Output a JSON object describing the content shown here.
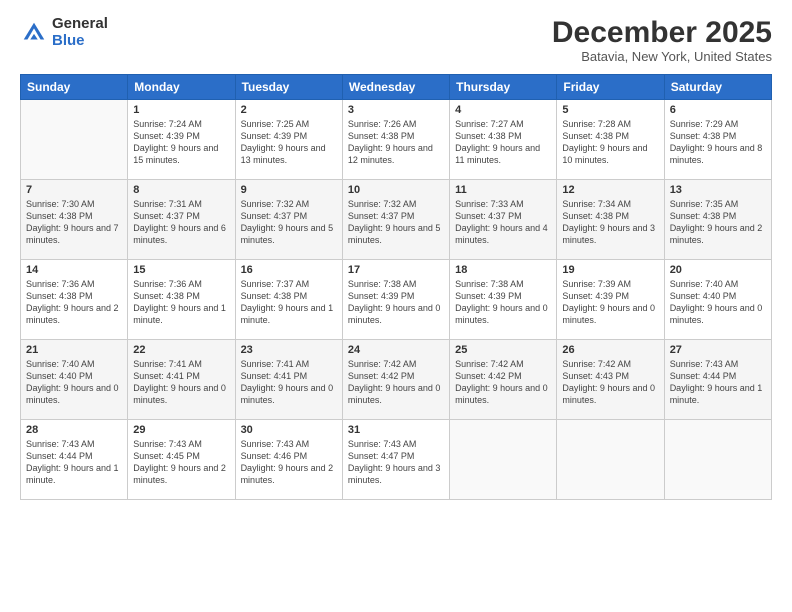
{
  "header": {
    "logo_general": "General",
    "logo_blue": "Blue",
    "month_title": "December 2025",
    "location": "Batavia, New York, United States"
  },
  "weekdays": [
    "Sunday",
    "Monday",
    "Tuesday",
    "Wednesday",
    "Thursday",
    "Friday",
    "Saturday"
  ],
  "weeks": [
    [
      {
        "day": "",
        "sunrise": "",
        "sunset": "",
        "daylight": ""
      },
      {
        "day": "1",
        "sunrise": "Sunrise: 7:24 AM",
        "sunset": "Sunset: 4:39 PM",
        "daylight": "Daylight: 9 hours and 15 minutes."
      },
      {
        "day": "2",
        "sunrise": "Sunrise: 7:25 AM",
        "sunset": "Sunset: 4:39 PM",
        "daylight": "Daylight: 9 hours and 13 minutes."
      },
      {
        "day": "3",
        "sunrise": "Sunrise: 7:26 AM",
        "sunset": "Sunset: 4:38 PM",
        "daylight": "Daylight: 9 hours and 12 minutes."
      },
      {
        "day": "4",
        "sunrise": "Sunrise: 7:27 AM",
        "sunset": "Sunset: 4:38 PM",
        "daylight": "Daylight: 9 hours and 11 minutes."
      },
      {
        "day": "5",
        "sunrise": "Sunrise: 7:28 AM",
        "sunset": "Sunset: 4:38 PM",
        "daylight": "Daylight: 9 hours and 10 minutes."
      },
      {
        "day": "6",
        "sunrise": "Sunrise: 7:29 AM",
        "sunset": "Sunset: 4:38 PM",
        "daylight": "Daylight: 9 hours and 8 minutes."
      }
    ],
    [
      {
        "day": "7",
        "sunrise": "Sunrise: 7:30 AM",
        "sunset": "Sunset: 4:38 PM",
        "daylight": "Daylight: 9 hours and 7 minutes."
      },
      {
        "day": "8",
        "sunrise": "Sunrise: 7:31 AM",
        "sunset": "Sunset: 4:37 PM",
        "daylight": "Daylight: 9 hours and 6 minutes."
      },
      {
        "day": "9",
        "sunrise": "Sunrise: 7:32 AM",
        "sunset": "Sunset: 4:37 PM",
        "daylight": "Daylight: 9 hours and 5 minutes."
      },
      {
        "day": "10",
        "sunrise": "Sunrise: 7:32 AM",
        "sunset": "Sunset: 4:37 PM",
        "daylight": "Daylight: 9 hours and 5 minutes."
      },
      {
        "day": "11",
        "sunrise": "Sunrise: 7:33 AM",
        "sunset": "Sunset: 4:37 PM",
        "daylight": "Daylight: 9 hours and 4 minutes."
      },
      {
        "day": "12",
        "sunrise": "Sunrise: 7:34 AM",
        "sunset": "Sunset: 4:38 PM",
        "daylight": "Daylight: 9 hours and 3 minutes."
      },
      {
        "day": "13",
        "sunrise": "Sunrise: 7:35 AM",
        "sunset": "Sunset: 4:38 PM",
        "daylight": "Daylight: 9 hours and 2 minutes."
      }
    ],
    [
      {
        "day": "14",
        "sunrise": "Sunrise: 7:36 AM",
        "sunset": "Sunset: 4:38 PM",
        "daylight": "Daylight: 9 hours and 2 minutes."
      },
      {
        "day": "15",
        "sunrise": "Sunrise: 7:36 AM",
        "sunset": "Sunset: 4:38 PM",
        "daylight": "Daylight: 9 hours and 1 minute."
      },
      {
        "day": "16",
        "sunrise": "Sunrise: 7:37 AM",
        "sunset": "Sunset: 4:38 PM",
        "daylight": "Daylight: 9 hours and 1 minute."
      },
      {
        "day": "17",
        "sunrise": "Sunrise: 7:38 AM",
        "sunset": "Sunset: 4:39 PM",
        "daylight": "Daylight: 9 hours and 0 minutes."
      },
      {
        "day": "18",
        "sunrise": "Sunrise: 7:38 AM",
        "sunset": "Sunset: 4:39 PM",
        "daylight": "Daylight: 9 hours and 0 minutes."
      },
      {
        "day": "19",
        "sunrise": "Sunrise: 7:39 AM",
        "sunset": "Sunset: 4:39 PM",
        "daylight": "Daylight: 9 hours and 0 minutes."
      },
      {
        "day": "20",
        "sunrise": "Sunrise: 7:40 AM",
        "sunset": "Sunset: 4:40 PM",
        "daylight": "Daylight: 9 hours and 0 minutes."
      }
    ],
    [
      {
        "day": "21",
        "sunrise": "Sunrise: 7:40 AM",
        "sunset": "Sunset: 4:40 PM",
        "daylight": "Daylight: 9 hours and 0 minutes."
      },
      {
        "day": "22",
        "sunrise": "Sunrise: 7:41 AM",
        "sunset": "Sunset: 4:41 PM",
        "daylight": "Daylight: 9 hours and 0 minutes."
      },
      {
        "day": "23",
        "sunrise": "Sunrise: 7:41 AM",
        "sunset": "Sunset: 4:41 PM",
        "daylight": "Daylight: 9 hours and 0 minutes."
      },
      {
        "day": "24",
        "sunrise": "Sunrise: 7:42 AM",
        "sunset": "Sunset: 4:42 PM",
        "daylight": "Daylight: 9 hours and 0 minutes."
      },
      {
        "day": "25",
        "sunrise": "Sunrise: 7:42 AM",
        "sunset": "Sunset: 4:42 PM",
        "daylight": "Daylight: 9 hours and 0 minutes."
      },
      {
        "day": "26",
        "sunrise": "Sunrise: 7:42 AM",
        "sunset": "Sunset: 4:43 PM",
        "daylight": "Daylight: 9 hours and 0 minutes."
      },
      {
        "day": "27",
        "sunrise": "Sunrise: 7:43 AM",
        "sunset": "Sunset: 4:44 PM",
        "daylight": "Daylight: 9 hours and 1 minute."
      }
    ],
    [
      {
        "day": "28",
        "sunrise": "Sunrise: 7:43 AM",
        "sunset": "Sunset: 4:44 PM",
        "daylight": "Daylight: 9 hours and 1 minute."
      },
      {
        "day": "29",
        "sunrise": "Sunrise: 7:43 AM",
        "sunset": "Sunset: 4:45 PM",
        "daylight": "Daylight: 9 hours and 2 minutes."
      },
      {
        "day": "30",
        "sunrise": "Sunrise: 7:43 AM",
        "sunset": "Sunset: 4:46 PM",
        "daylight": "Daylight: 9 hours and 2 minutes."
      },
      {
        "day": "31",
        "sunrise": "Sunrise: 7:43 AM",
        "sunset": "Sunset: 4:47 PM",
        "daylight": "Daylight: 9 hours and 3 minutes."
      },
      {
        "day": "",
        "sunrise": "",
        "sunset": "",
        "daylight": ""
      },
      {
        "day": "",
        "sunrise": "",
        "sunset": "",
        "daylight": ""
      },
      {
        "day": "",
        "sunrise": "",
        "sunset": "",
        "daylight": ""
      }
    ]
  ]
}
